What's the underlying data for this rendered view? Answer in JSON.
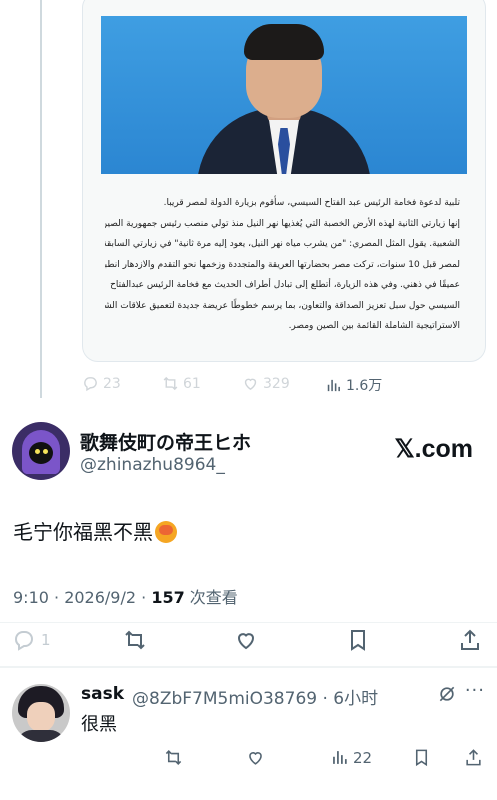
{
  "quoted": {
    "arabic_lines": [
      "تلبية لدعوة فخامة الرئيس عبد الفتاح السيسي، سأقوم بزيارة الدولة لمصر قريبا.",
      "إنها زيارتي الثانية لهذه الأرض الخصبة التي يُغذيها نهر النيل منذ تولي منصب رئيس جمهورية الصين",
      "الشعبية. يقول المثل المصري: \"من يشرب مياه نهر النيل، يعود إليه مرة ثانية\" في زيارتي السابقة",
      "لمصر قبل 10 سنوات، تركت مصر بحضارتها العريقة والمتجددة وزخمها نحو التقدم والازدهار انطباعًا",
      "عميقًا في ذهني. وفي هذه الزيارة، أتطلع إلى تبادل أطراف الحديث مع فخامة الرئيس عبدالفتاح",
      "السيسي حول سبل تعزيز الصداقة والتعاون، بما يرسم خطوطًا عريضة جديدة لتعميق علاقات الشراكة",
      "الاستراتيجية الشاملة القائمة بين الصين ومصر."
    ],
    "replies": "23",
    "reposts": "61",
    "likes": "329",
    "views": "1.6万"
  },
  "author": {
    "display_name": "歌舞伎町の帝王ヒホ",
    "handle": "@zhinazhu8964_",
    "brand": "𝕏.com"
  },
  "tweet": {
    "text": "毛宁你福黑不黑",
    "time": "9:10 · 2026/9/2 · ",
    "views_count": "157",
    "views_label": " 次查看",
    "reply_count": "1"
  },
  "reply": {
    "name": "sask",
    "handle": "@8ZbF7M5miO38769 · 6小时",
    "more": "···",
    "text": "很黑",
    "views": "22"
  },
  "colors": {
    "text": "#0f1419",
    "muted": "#536471",
    "faded": "#d0d5d9",
    "photo_bg": "#3f9ee2"
  }
}
